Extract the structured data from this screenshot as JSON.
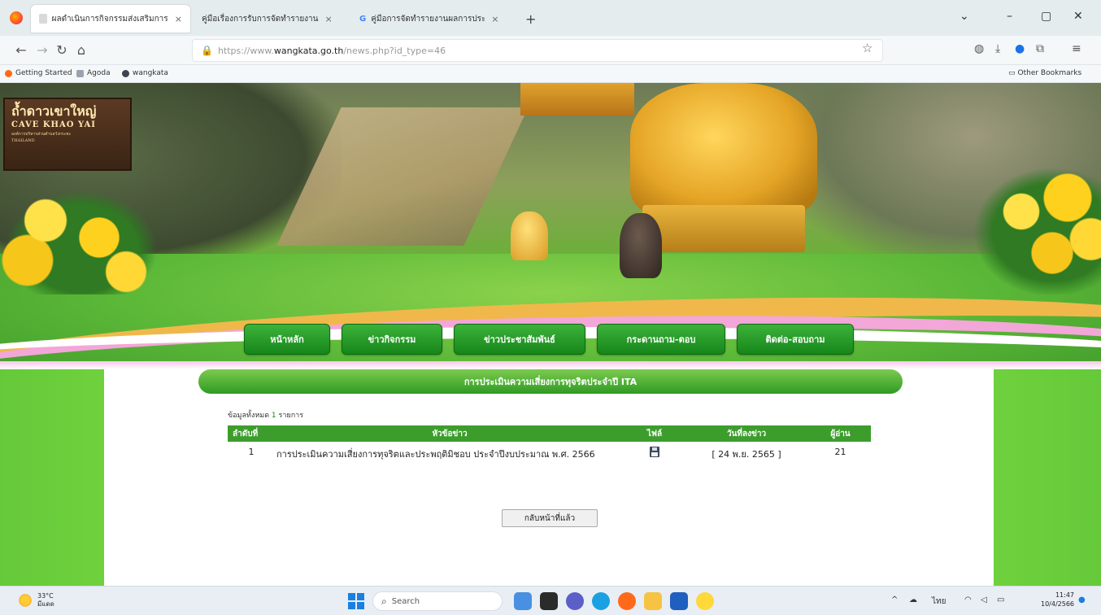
{
  "browser": {
    "tabs": [
      {
        "title": "ผลดำเนินการกิจกรรมส่งเสริมการร ค่าย...",
        "close": "×"
      },
      {
        "title": "คู่มือเรื่องการรับการจัดทำรายงาน",
        "close": "×"
      },
      {
        "title": "คู่มือการจัดทำรายงานผลการประเมินความเสี่ยง",
        "close": "×"
      }
    ],
    "new_tab": "+",
    "window_controls": {
      "list": "⌄",
      "minimize": "–",
      "maximize": "▢",
      "close": "✕"
    },
    "url_domain": "wangkata.go.th",
    "url_prefix": "https://www.",
    "url_suffix": "/news.php?id_type=46",
    "lock_glyph": "🔒",
    "bookmarks": [
      {
        "label": "Getting Started"
      },
      {
        "label": "Agoda"
      },
      {
        "label": "wangkata"
      }
    ],
    "other_bookmarks": "Other Bookmarks"
  },
  "banner": {
    "sign_line1": "ถ้ำดาวเขาใหญ่",
    "sign_line2": "CAVE KHAO YAI",
    "sign_line3": "องค์การบริหารส่วนตำบลวังกระทะ",
    "sign_line4": "THAILAND"
  },
  "menu": {
    "items": [
      {
        "label": "หน้าหลัก"
      },
      {
        "label": "ข่าวกิจกรรม"
      },
      {
        "label": "ข่าวประชาสัมพันธ์"
      },
      {
        "label": "กระดานถาม-ตอบ"
      },
      {
        "label": "ติดต่อ-สอบถาม"
      }
    ]
  },
  "content": {
    "section_title": "การประเมินความเสี่ยงการทุจริตประจำปี ITA",
    "count_prefix": "ข้อมูลทั้งหมด",
    "count_value": "1",
    "count_suffix": "รายการ",
    "table": {
      "headers": [
        "ลำดับที่",
        "หัวข้อข่าว",
        "ไฟล์",
        "วันที่ลงข่าว",
        "ผู้อ่าน"
      ],
      "rows": [
        {
          "no": "1",
          "title": "การประเมินความเสี่ยงการทุจริตและประพฤติมิชอบ ประจำปีงบประมาณ พ.ศ. 2566",
          "file_icon": "floppy-disk-icon",
          "date": "[ 24 พ.ย. 2565 ]",
          "readers": "21"
        }
      ]
    },
    "back_button": "กลับหน้าที่แล้ว"
  },
  "taskbar": {
    "weather_temp": "33°C",
    "weather_desc": "มีแดด",
    "search_placeholder": "Search",
    "tray_lang": "ไทย",
    "time": "11:47",
    "date": "10/4/2566"
  },
  "colors": {
    "menu_green": "#16861a",
    "header_green": "#2f9a24",
    "table_header": "#3c9d2c",
    "side_green": "#6fd13c"
  }
}
